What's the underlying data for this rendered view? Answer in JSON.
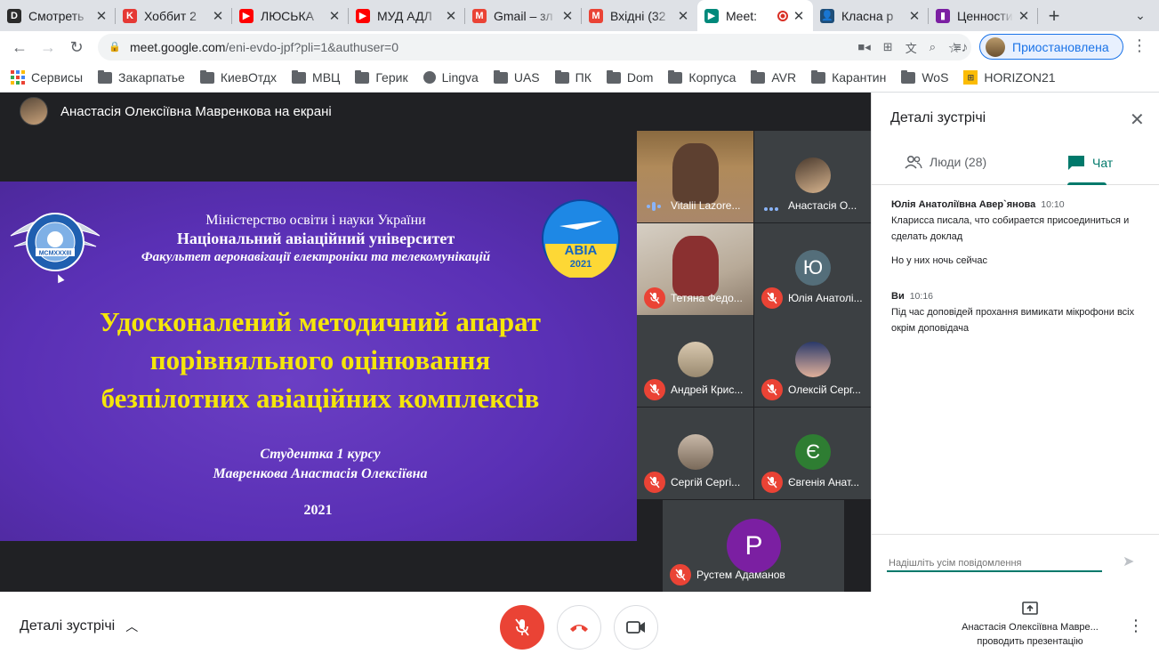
{
  "tabs": [
    {
      "title": "Смотреть",
      "icon": "d-icon",
      "color": "#2b2b2b",
      "label": "D"
    },
    {
      "title": "Хоббит 2",
      "icon": "k-icon",
      "color": "#e53935",
      "label": "K"
    },
    {
      "title": "ЛЮСЬКА",
      "icon": "youtube-icon",
      "color": "#ff0000",
      "label": "▶"
    },
    {
      "title": "МУД АДЛ",
      "icon": "youtube-icon",
      "color": "#ff0000",
      "label": "▶"
    },
    {
      "title": "Gmail – зл",
      "icon": "gmail-icon",
      "color": "#ea4335",
      "label": "M"
    },
    {
      "title": "Вхідні (32",
      "icon": "gmail-icon",
      "color": "#ea4335",
      "label": "M"
    },
    {
      "title": "Meet:",
      "icon": "meet-icon",
      "color": "#00897b",
      "label": "▶"
    },
    {
      "title": "Класна р",
      "icon": "classroom-icon",
      "color": "#1e4e79",
      "label": "👤"
    },
    {
      "title": "Ценности",
      "icon": "podcast-icon",
      "color": "#7b1fa2",
      "label": "▮"
    }
  ],
  "address": {
    "host": "meet.google.com",
    "path": "/eni-evdo-jpf?pli=1&authuser=0"
  },
  "profile_label": "Приостановлена",
  "bookmarks": [
    {
      "label": "Сервисы",
      "type": "apps"
    },
    {
      "label": "Закарпатье",
      "type": "folder"
    },
    {
      "label": "КиевОтдх",
      "type": "folder"
    },
    {
      "label": "МВЦ",
      "type": "folder"
    },
    {
      "label": "Герик",
      "type": "folder"
    },
    {
      "label": "Lingva",
      "type": "globe"
    },
    {
      "label": "UAS",
      "type": "folder"
    },
    {
      "label": "ПК",
      "type": "folder"
    },
    {
      "label": "Dom",
      "type": "folder"
    },
    {
      "label": "Корпуса",
      "type": "folder"
    },
    {
      "label": "AVR",
      "type": "folder"
    },
    {
      "label": "Карантин",
      "type": "folder"
    },
    {
      "label": "WoS",
      "type": "folder"
    },
    {
      "label": "HORIZON21",
      "type": "horizon"
    }
  ],
  "presenter_label": "Анастасія Олексіївна Мавренкова на екрані",
  "slide": {
    "line1": "Міністерство освіти і науки України",
    "line2": "Національний авіаційний університет",
    "line3": "Факультет аеронавігації електроніки та телекомунікацій",
    "title1": "Удосконалений методичний апарат",
    "title2": "порівняльного оцінювання",
    "title3": "безпілотних авіаційних комплексів",
    "student1": "Студентка 1 курсу",
    "student2": "Мавренкова Анастасія Олексіївна",
    "year": "2021",
    "logo_left_text": "MCMXXXIII",
    "logo_right_text1": "АВІА",
    "logo_right_text2": "2021"
  },
  "participants": [
    {
      "name": "Vitalii Lazore...",
      "state": "speaking"
    },
    {
      "name": "Анастасія О...",
      "state": "dots"
    },
    {
      "name": "Тетяна Федо...",
      "state": "muted"
    },
    {
      "name": "Юлія Анатолі...",
      "state": "muted",
      "letter": "Ю"
    },
    {
      "name": "Андрей Крис...",
      "state": "muted"
    },
    {
      "name": "Олексій Серг...",
      "state": "muted"
    },
    {
      "name": "Сергій Сергі...",
      "state": "muted"
    },
    {
      "name": "Євгенія Анат...",
      "state": "muted",
      "letter": "Є"
    },
    {
      "name": "Рустем Адаманов",
      "state": "muted",
      "letter": "Р"
    }
  ],
  "panel": {
    "title": "Деталі зустрічі",
    "people_tab": "Люди (28)",
    "chat_tab": "Чат",
    "messages": [
      {
        "sender": "Юлія Анатоліївна Авер`янова",
        "time": "10:10",
        "lines": [
          "Кларисса писала, что собирается присоединиться и сделать доклад",
          "Но у них ночь сейчас"
        ]
      },
      {
        "sender": "Ви",
        "time": "10:16",
        "lines": [
          "Під час доповідей прохання вимикати мікрофони всіх окрім доповідача"
        ]
      }
    ],
    "input_placeholder": "Надішліть усім повідомлення"
  },
  "bottom": {
    "details_label": "Деталі зустрічі",
    "presenting_name": "Анастасія Олексіївна Мавре...",
    "presenting_label": "проводить презентацію"
  },
  "colors": {
    "meet_bg": "#202124",
    "tile_bg": "#3c4043",
    "mute_red": "#ea4335",
    "chat_accent": "#00796b",
    "slide_title": "#f5e60a"
  }
}
